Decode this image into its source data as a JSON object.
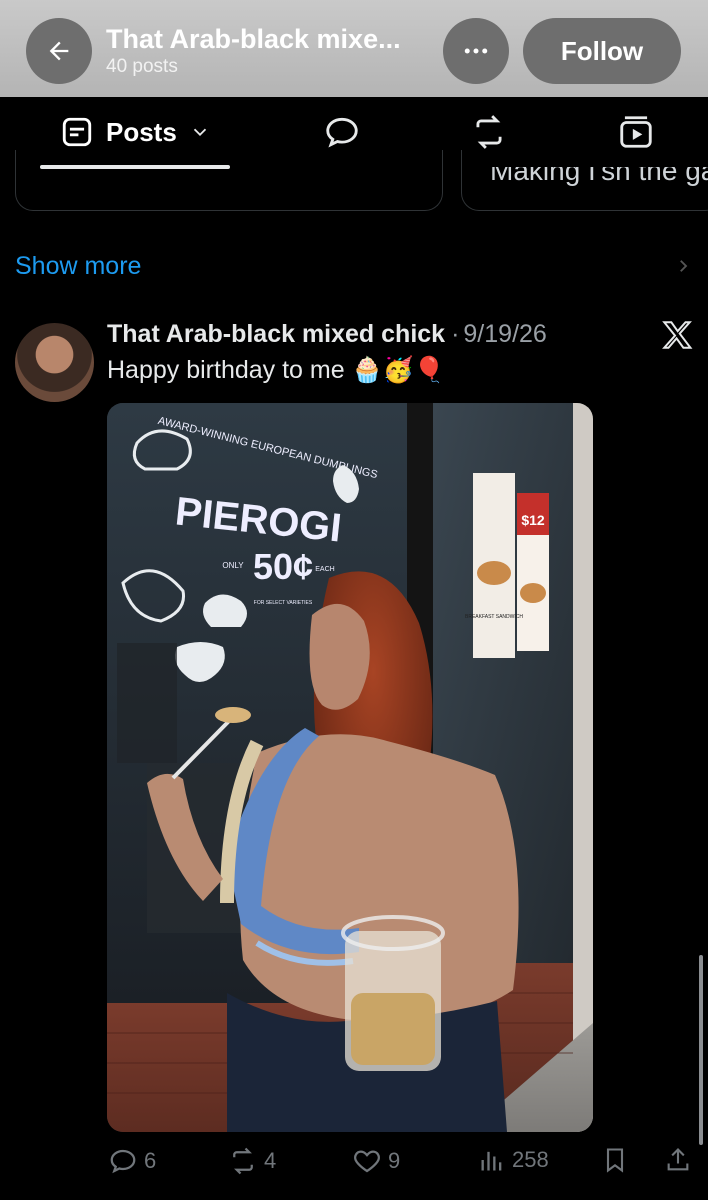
{
  "header": {
    "title": "That Arab-black mixe...",
    "posts_count": "40 posts",
    "follow_label": "Follow",
    "back_icon": "arrow-left-icon",
    "more_icon": "ellipsis-icon"
  },
  "tabs": {
    "posts_label": "Posts",
    "icons": [
      "posts-tab-icon",
      "chevron-down-icon",
      "replies-icon",
      "reposts-icon",
      "media-icon"
    ]
  },
  "cards": {
    "partial_text": "Making I'sh the gar"
  },
  "show_more": "Show more",
  "post": {
    "author": "That Arab-black mixed chick",
    "separator": "·",
    "date": "9/19/26",
    "text": "Happy birthday to me 🧁🥳🎈",
    "photo": {
      "storefront_text": [
        "AWARD-WINNING EUROPEAN DUMPLINGS",
        "PIEROGI",
        "ONLY",
        "50¢",
        "EACH",
        "FOR SELECT VARIETIES"
      ],
      "poster_text": [
        "$12",
        "BREAKFAST SANDWICH"
      ]
    },
    "stats": {
      "replies": "6",
      "reposts": "4",
      "likes": "9",
      "views": "258"
    }
  },
  "colors": {
    "accent": "#1d9bf0",
    "muted": "#71767b",
    "topbar": "#bcbcbc"
  }
}
